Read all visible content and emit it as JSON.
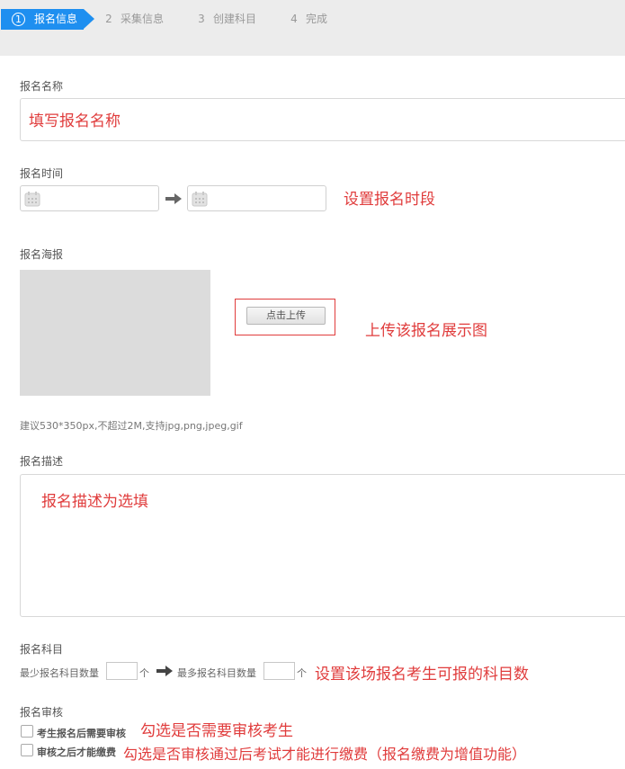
{
  "steps": [
    {
      "num": "1",
      "label": "报名信息"
    },
    {
      "num": "2",
      "label": "采集信息"
    },
    {
      "num": "3",
      "label": "创建科目"
    },
    {
      "num": "4",
      "label": "完成"
    }
  ],
  "form": {
    "name_label": "报名名称",
    "time_label": "报名时间",
    "poster_label": "报名海报",
    "upload_button": "点击上传",
    "poster_hint": "建议530*350px,不超过2M,支持jpg,png,jpeg,gif",
    "desc_label": "报名描述",
    "subject_label": "报名科目",
    "min_subjects_label": "最少报名科目数量",
    "max_subjects_label": "最多报名科目数量",
    "unit": "个",
    "review_label": "报名审核",
    "check_review": "考生报名后需要审核",
    "check_pay": "审核之后才能缴费"
  },
  "annotations": {
    "name": "填写报名名称",
    "time": "设置报名时段",
    "upload": "上传该报名展示图",
    "desc": "报名描述为选填",
    "subjects": "设置该场报名考生可报的科目数",
    "review": "勾选是否需要审核考生",
    "pay": "勾选是否审核通过后考试才能进行缴费（报名缴费为增值功能）"
  },
  "colors": {
    "step_active": "#1e8ff0",
    "annotation": "#e03c3c"
  },
  "icons": {
    "calendar": "calendar-icon",
    "arrow": "arrow-right-icon"
  }
}
